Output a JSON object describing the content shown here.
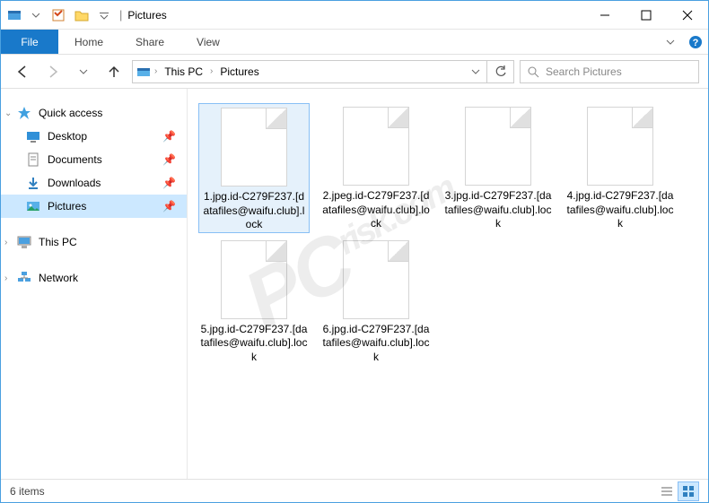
{
  "window": {
    "title": "Pictures"
  },
  "ribbon": {
    "file": "File",
    "tabs": [
      "Home",
      "Share",
      "View"
    ]
  },
  "nav": {
    "crumbs": [
      "This PC",
      "Pictures"
    ],
    "search_placeholder": "Search Pictures"
  },
  "sidebar": {
    "quick_access": "Quick access",
    "items": [
      {
        "label": "Desktop",
        "pinned": true
      },
      {
        "label": "Documents",
        "pinned": true
      },
      {
        "label": "Downloads",
        "pinned": true
      },
      {
        "label": "Pictures",
        "pinned": true,
        "selected": true
      }
    ],
    "this_pc": "This PC",
    "network": "Network"
  },
  "files": [
    {
      "name": "1.jpg.id-C279F237.[datafiles@waifu.club].lock"
    },
    {
      "name": "2.jpeg.id-C279F237.[datafiles@waifu.club].lock"
    },
    {
      "name": "3.jpg.id-C279F237.[datafiles@waifu.club].lock"
    },
    {
      "name": "4.jpg.id-C279F237.[datafiles@waifu.club].lock"
    },
    {
      "name": "5.jpg.id-C279F237.[datafiles@waifu.club].lock"
    },
    {
      "name": "6.jpg.id-C279F237.[datafiles@waifu.club].lock"
    }
  ],
  "status": {
    "count_label": "6 items"
  }
}
